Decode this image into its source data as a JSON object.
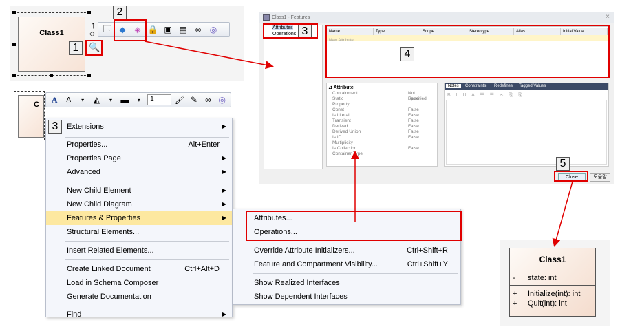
{
  "top_element": {
    "class_name": "Class1",
    "callout_1": "1",
    "callout_2": "2"
  },
  "second_element": {
    "class_name_partial": "C",
    "font_size_value": "1"
  },
  "context_menu": {
    "callout": "3",
    "items": [
      {
        "label": "Extensions",
        "shortcut": "",
        "submenu": true
      },
      {
        "label": "Properties...",
        "shortcut": "Alt+Enter",
        "submenu": false
      },
      {
        "label": "Properties Page",
        "shortcut": "",
        "submenu": true
      },
      {
        "label": "Advanced",
        "shortcut": "",
        "submenu": true
      },
      {
        "label": "New Child Element",
        "shortcut": "",
        "submenu": true
      },
      {
        "label": "New Child Diagram",
        "shortcut": "",
        "submenu": true
      },
      {
        "label": "Features & Properties",
        "shortcut": "",
        "submenu": true
      },
      {
        "label": "Structural Elements...",
        "shortcut": "",
        "submenu": false
      },
      {
        "label": "Insert Related Elements...",
        "shortcut": "",
        "submenu": false
      },
      {
        "label": "Create Linked Document",
        "shortcut": "Ctrl+Alt+D",
        "submenu": false
      },
      {
        "label": "Load in Schema Composer",
        "shortcut": "",
        "submenu": false
      },
      {
        "label": "Generate Documentation",
        "shortcut": "",
        "submenu": false
      },
      {
        "label": "Find",
        "shortcut": "",
        "submenu": true
      }
    ]
  },
  "submenu": {
    "items": [
      {
        "label": "Attributes...",
        "shortcut": ""
      },
      {
        "label": "Operations...",
        "shortcut": ""
      },
      {
        "label": "Override Attribute Initializers...",
        "shortcut": "Ctrl+Shift+R"
      },
      {
        "label": "Feature and Compartment Visibility...",
        "shortcut": "Ctrl+Shift+Y"
      },
      {
        "label": "Show Realized Interfaces",
        "shortcut": ""
      },
      {
        "label": "Show Dependent Interfaces",
        "shortcut": ""
      }
    ]
  },
  "dialog": {
    "title": "Class1 - Features",
    "close_glyph": "×",
    "tree": [
      "Attributes",
      "Operations"
    ],
    "callout_3": "3",
    "callout_4": "4",
    "callout_5": "5",
    "columns": [
      "Name",
      "Type",
      "Scope",
      "Stereotype",
      "Alias",
      "Initial Value"
    ],
    "new_row_placeholder": "New Attribute...",
    "properties_header": "Attribute",
    "properties": [
      {
        "name": "Containment",
        "value": "Not Specified"
      },
      {
        "name": "Static",
        "value": "False"
      },
      {
        "name": "Property",
        "value": ""
      },
      {
        "name": "Const",
        "value": "False"
      },
      {
        "name": "Is Literal",
        "value": "False"
      },
      {
        "name": "Transient",
        "value": "False"
      },
      {
        "name": "Derived",
        "value": "False"
      },
      {
        "name": "Derived Union",
        "value": "False"
      },
      {
        "name": "Is ID",
        "value": "False"
      },
      {
        "name": "Multiplicity",
        "value": ""
      },
      {
        "name": "Is Collection",
        "value": "False"
      },
      {
        "name": "Container Type",
        "value": ""
      }
    ],
    "notes_tabs": [
      "Notes",
      "Constraints",
      "Redefines",
      "Tagged Values"
    ],
    "close_button": "Close",
    "help_button": "도움말"
  },
  "result_class": {
    "name": "Class1",
    "attributes": [
      {
        "visibility": "-",
        "text": "state: int"
      }
    ],
    "operations": [
      {
        "visibility": "+",
        "text": "Initialize(int): int"
      },
      {
        "visibility": "+",
        "text": "Quit(int): int"
      }
    ]
  },
  "colors": {
    "highlight_red": "#e00000",
    "menu_highlight": "#fde8a0",
    "grid_header_yellow": "#fff5c8"
  }
}
